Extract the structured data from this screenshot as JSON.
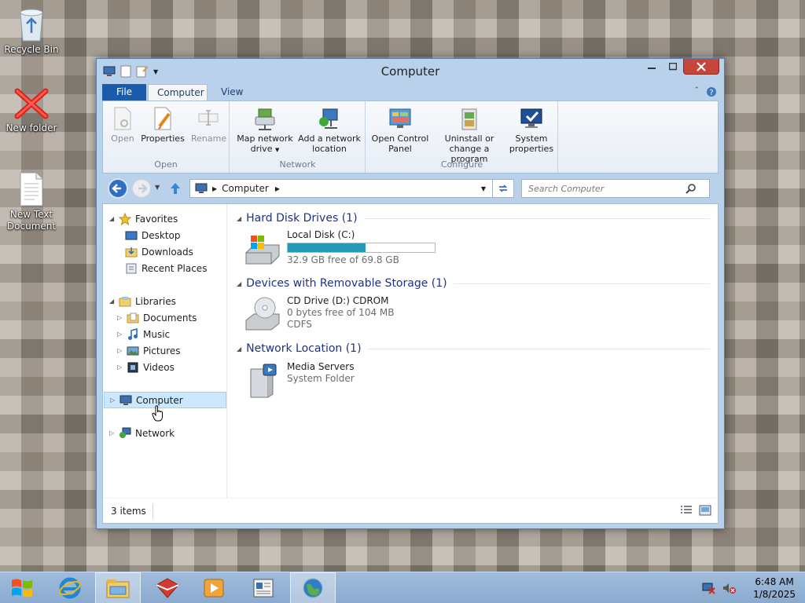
{
  "desktop": {
    "icons": [
      {
        "label": "Recycle Bin",
        "icon": "recycle-bin-icon"
      },
      {
        "label": "New folder",
        "icon": "folder-x-icon"
      },
      {
        "label": "New Text Document",
        "icon": "text-document-icon"
      }
    ]
  },
  "window": {
    "title": "Computer",
    "tabs": {
      "file": "File",
      "computer": "Computer",
      "view": "View"
    },
    "ribbon": {
      "groups": {
        "open": "Open",
        "network": "Network",
        "configure": "Configure"
      },
      "buttons": {
        "open": "Open",
        "properties": "Properties",
        "rename": "Rename",
        "map_drive_l1": "Map network",
        "map_drive_l2": "drive",
        "add_location_l1": "Add a network",
        "add_location_l2": "location",
        "control_panel_l1": "Open Control",
        "control_panel_l2": "Panel",
        "uninstall_l1": "Uninstall or",
        "uninstall_l2": "change a program",
        "system_l1": "System",
        "system_l2": "properties"
      }
    },
    "address": {
      "path": "Computer"
    },
    "search": {
      "placeholder": "Search Computer"
    },
    "nav": {
      "favorites": "Favorites",
      "desktop": "Desktop",
      "downloads": "Downloads",
      "recent": "Recent Places",
      "libraries": "Libraries",
      "documents": "Documents",
      "music": "Music",
      "pictures": "Pictures",
      "videos": "Videos",
      "computer": "Computer",
      "network": "Network"
    },
    "groups": {
      "hdd": {
        "header": "Hard Disk Drives (1)",
        "name": "Local Disk (C:)",
        "free": "32.9 GB free of 69.8 GB",
        "used_fraction": 0.53
      },
      "removable": {
        "header": "Devices with Removable Storage (1)",
        "name": "CD Drive (D:) CDROM",
        "free": "0 bytes free of 104 MB",
        "fs": "CDFS"
      },
      "network": {
        "header": "Network Location (1)",
        "name": "Media Servers",
        "type": "System Folder"
      }
    },
    "status": {
      "items": "3 items"
    }
  },
  "taskbar": {
    "time": "6:48 AM",
    "date": "1/8/2025"
  },
  "colors": {
    "accent": "#1a5bac",
    "drive_bar": "#2699b7",
    "close": "#c7463a"
  }
}
